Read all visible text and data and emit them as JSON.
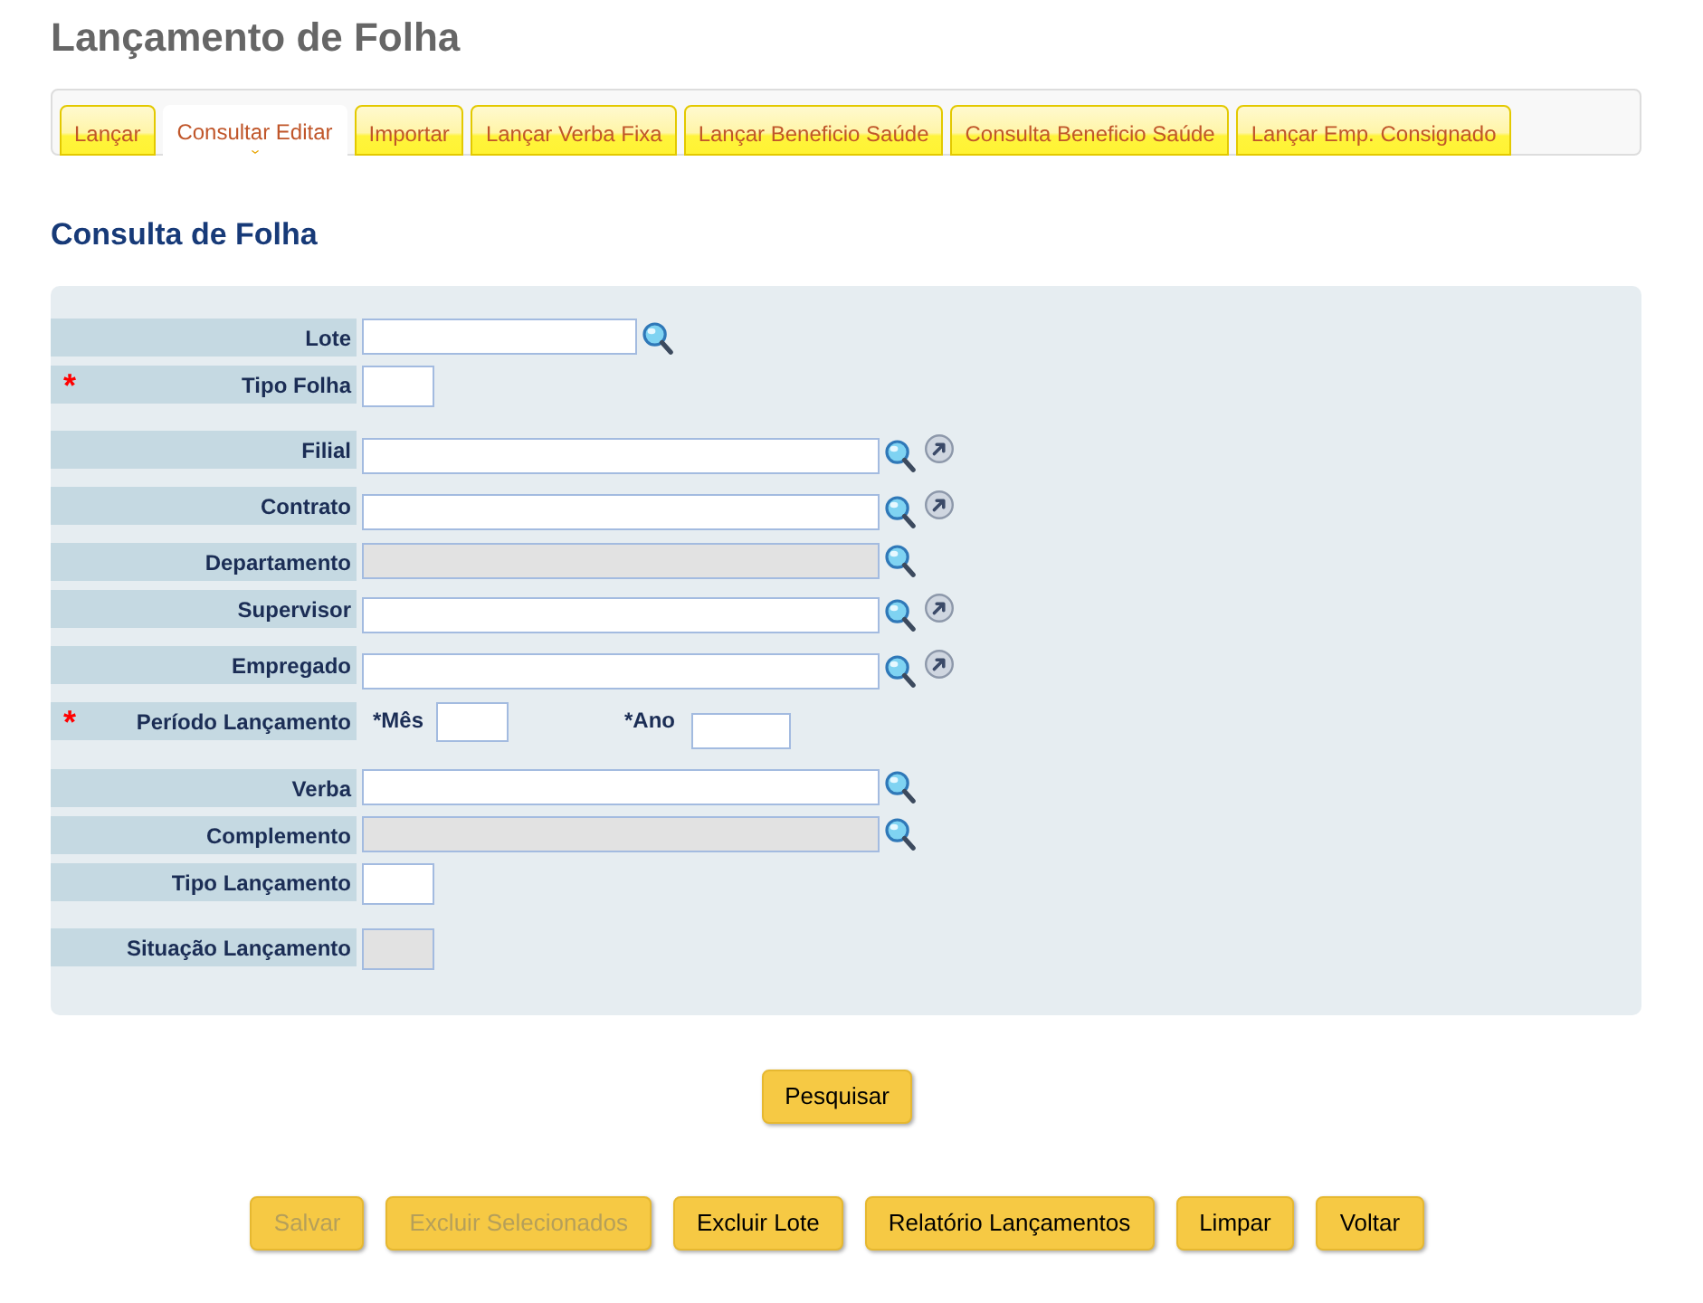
{
  "page": {
    "title": "Lançamento de Folha"
  },
  "tabs": [
    {
      "label": "Lançar",
      "selected": false
    },
    {
      "label": "Consultar Editar",
      "selected": true
    },
    {
      "label": "Importar",
      "selected": false
    },
    {
      "label": "Lançar Verba Fixa",
      "selected": false
    },
    {
      "label": "Lançar Beneficio Saúde",
      "selected": false
    },
    {
      "label": "Consulta Beneficio Saúde",
      "selected": false
    },
    {
      "label": "Lançar Emp. Consignado",
      "selected": false
    }
  ],
  "section": {
    "title": "Consulta de Folha"
  },
  "form": {
    "rows": [
      {
        "kind": "number",
        "label": "Lote",
        "disabled": false,
        "has_search": true
      },
      {
        "kind": "code",
        "label": "Tipo Folha",
        "marker": "*",
        "disabled": false
      },
      {
        "kind": "lookup",
        "label": "Filial",
        "disabled": false,
        "has_search": true,
        "has_goto": true
      },
      {
        "kind": "lookup",
        "label": "Contrato",
        "disabled": false,
        "has_search": true,
        "has_goto": true
      },
      {
        "kind": "lookup",
        "label": "Departamento",
        "disabled": true,
        "has_search": true
      },
      {
        "kind": "lookup",
        "label": "Supervisor",
        "disabled": false,
        "has_search": true,
        "has_goto": true
      },
      {
        "kind": "lookup",
        "label": "Empregado",
        "disabled": false,
        "has_search": true,
        "has_goto": true
      },
      {
        "kind": "period",
        "label": "Período Lançamento",
        "marker": "*",
        "parts": [
          {
            "label": "*Mês"
          },
          {
            "label": "*Ano"
          }
        ]
      },
      {
        "kind": "lookup",
        "label": "Verba",
        "disabled": false,
        "has_search": true
      },
      {
        "kind": "lookup",
        "label": "Complemento",
        "disabled": true,
        "has_search": true
      },
      {
        "kind": "code",
        "label": "Tipo Lançamento",
        "disabled": false
      },
      {
        "kind": "code",
        "label": "Situação Lançamento",
        "disabled": true
      }
    ]
  },
  "search_button": {
    "label": "Pesquisar"
  },
  "actions": [
    {
      "label": "Salvar",
      "disabled": true
    },
    {
      "label": "Excluir Selecionados",
      "disabled": true
    },
    {
      "label": "Excluir Lote",
      "disabled": false
    },
    {
      "label": "Relatório Lançamentos",
      "disabled": false
    },
    {
      "label": "Limpar",
      "disabled": false
    },
    {
      "label": "Voltar",
      "disabled": false
    }
  ]
}
